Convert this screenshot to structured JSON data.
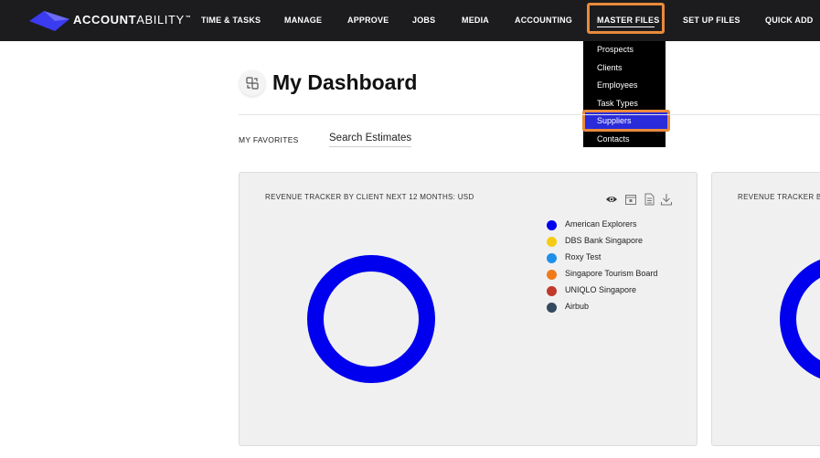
{
  "brand": {
    "name_bold": "ACCOUNT",
    "name_light": "ABILITY",
    "tm": "™",
    "accent_color": "#3b3bf0"
  },
  "nav": {
    "items": [
      {
        "label": "TIME & TASKS"
      },
      {
        "label": "MANAGE"
      },
      {
        "label": "APPROVE"
      },
      {
        "label": "JOBS"
      },
      {
        "label": "MEDIA"
      },
      {
        "label": "ACCOUNTING"
      },
      {
        "label": "MASTER FILES",
        "active": true
      },
      {
        "label": "SET UP FILES"
      },
      {
        "label": "QUICK ADD"
      }
    ],
    "highlight_color": "#e98a3b"
  },
  "dropdown": {
    "items": [
      {
        "label": "Prospects"
      },
      {
        "label": "Clients"
      },
      {
        "label": "Employees"
      },
      {
        "label": "Task Types"
      },
      {
        "label": "Suppliers",
        "selected": true
      },
      {
        "label": "Contacts"
      }
    ],
    "selected_bg": "#2a2bd9"
  },
  "page": {
    "title": "My Dashboard",
    "favorites_label": "MY FAVORITES",
    "favorites_link": "Search Estimates"
  },
  "cards": [
    {
      "title": "REVENUE TRACKER BY CLIENT NEXT 12 MONTHS: USD",
      "tools": [
        "eye-icon",
        "calendar-icon",
        "document-icon",
        "download-icon"
      ],
      "chart_data": {
        "type": "pie",
        "labels": [
          "American Explorers",
          "DBS Bank Singapore",
          "Roxy Test",
          "Singapore Tourism Board",
          "UNIQLO Singapore",
          "Airbub"
        ],
        "colors": [
          "#0000ee",
          "#f5cc13",
          "#1e90e8",
          "#f07a1a",
          "#c0392b",
          "#34495e"
        ],
        "values": [
          100,
          0,
          0,
          0,
          0,
          0
        ],
        "donut": true
      }
    },
    {
      "title": "REVENUE TRACKER BY"
    }
  ]
}
